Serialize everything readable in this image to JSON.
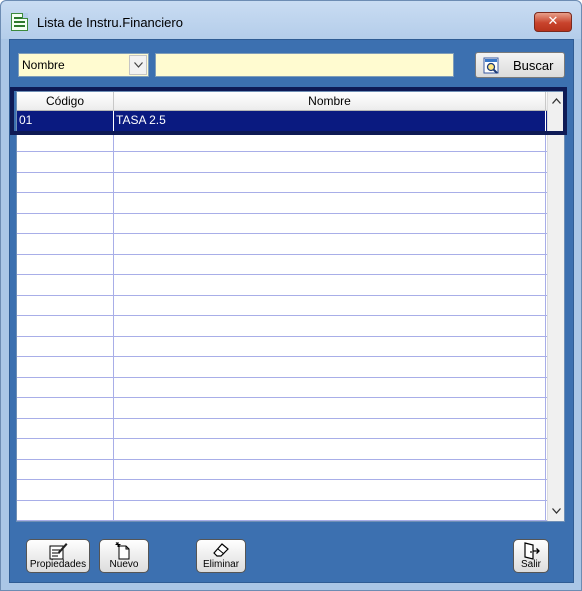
{
  "window": {
    "title": "Lista de Instru.Financiero",
    "close_symbol": "✕"
  },
  "search": {
    "field_selected": "Nombre",
    "input_value": "",
    "button_label": "Buscar"
  },
  "grid": {
    "columns": [
      "Código",
      "Nombre"
    ],
    "rows": [
      {
        "codigo": "01",
        "nombre": "TASA 2.5",
        "selected": true
      }
    ],
    "empty_rows": 19
  },
  "buttons": {
    "propiedades": "Propiedades",
    "nuevo": "Nuevo",
    "eliminar": "Eliminar",
    "salir": "Salir"
  },
  "icons": {
    "app": "list-document-icon",
    "buscar": "search-document-icon",
    "propiedades": "edit-document-icon",
    "nuevo": "new-document-icon",
    "eliminar": "eraser-icon",
    "salir": "exit-door-icon"
  },
  "colors": {
    "client_background": "#3c70b0",
    "input_background": "#fffbd0",
    "selected_row": "#0a1a80",
    "focus_frame": "#0e1a55"
  }
}
